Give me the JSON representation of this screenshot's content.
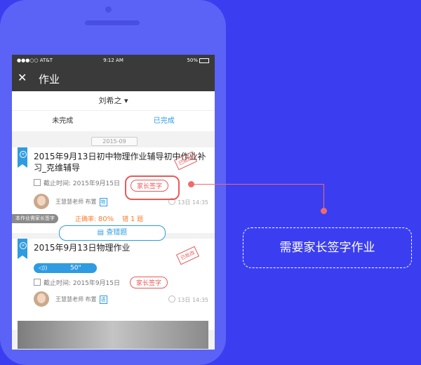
{
  "status": {
    "carrier": "●●●○○ AT&T",
    "time": "9:12 AM",
    "battery": "50%"
  },
  "nav": {
    "close": "✕",
    "title": "作业"
  },
  "student": {
    "name": "刘希之 ▾"
  },
  "tabs": [
    {
      "label": "未完成"
    },
    {
      "label": "已完成"
    }
  ],
  "month": "2015-09",
  "cards": [
    {
      "title": "2015年9月13日初中物理作业辅导初中作业补习_克维辅导",
      "deadline_label": "截止时间:",
      "deadline": "2015年9月15日",
      "sign_label": "家长签字",
      "stamp": "已批改",
      "teacher": "王慧慧老师 布置",
      "subject_tag": "物",
      "time": "13日 14:35",
      "parent_tag": "本作业需家长签字",
      "rate_label": "正确率:",
      "rate": "80%",
      "wrong_label": "错",
      "wrong_count": "1",
      "wrong_unit": "题",
      "check_button": "查错题"
    },
    {
      "title": "2015年9月13日物理作业",
      "audio_secs": "50\"",
      "deadline_label": "截止时间:",
      "deadline": "2015年9月15日",
      "sign_label": "家长签字",
      "stamp": "已批改",
      "teacher": "王慧慧老师 布置",
      "subject_tag": "语",
      "time": "13日 14:35"
    }
  ],
  "callout": {
    "text": "需要家长签字作业"
  },
  "colors": {
    "background": "#3b3ef0",
    "accent": "#2f9be0",
    "highlight": "#e85a5a",
    "rate": "#ff7a2b"
  }
}
